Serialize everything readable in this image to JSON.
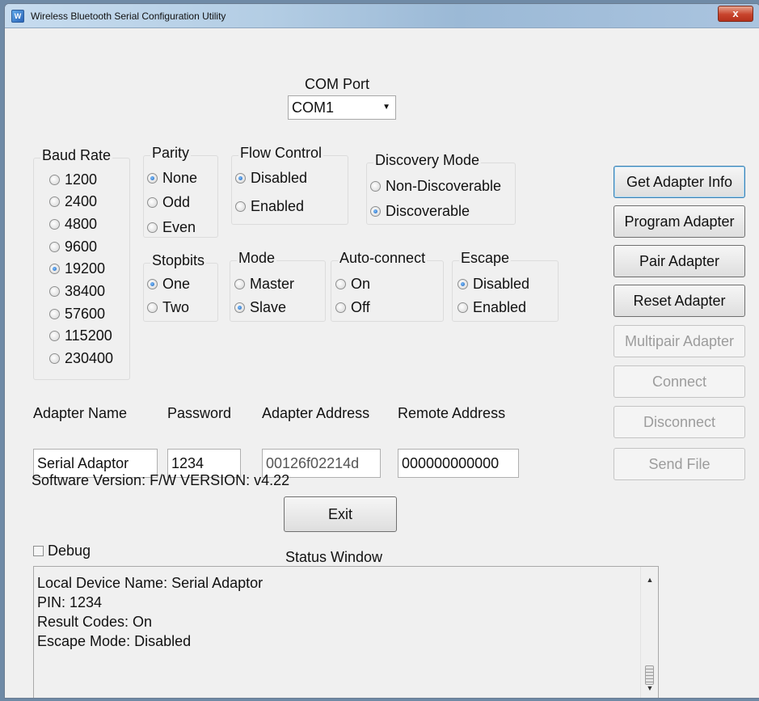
{
  "window": {
    "title": "Wireless Bluetooth Serial Configuration Utility",
    "close_glyph": "x",
    "icon": "bluetooth-app-icon"
  },
  "com_port": {
    "label": "COM Port",
    "value": "COM1"
  },
  "baud_rate": {
    "title": "Baud Rate",
    "options": [
      "1200",
      "2400",
      "4800",
      "9600",
      "19200",
      "38400",
      "57600",
      "115200",
      "230400"
    ],
    "selected": "19200"
  },
  "parity": {
    "title": "Parity",
    "options": [
      "None",
      "Odd",
      "Even"
    ],
    "selected": "None"
  },
  "flow_control": {
    "title": "Flow Control",
    "options": [
      "Disabled",
      "Enabled"
    ],
    "selected": "Disabled"
  },
  "discovery_mode": {
    "title": "Discovery Mode",
    "options": [
      "Non-Discoverable",
      "Discoverable"
    ],
    "selected": "Discoverable"
  },
  "stopbits": {
    "title": "Stopbits",
    "options": [
      "One",
      "Two"
    ],
    "selected": "One"
  },
  "mode": {
    "title": "Mode",
    "options": [
      "Master",
      "Slave"
    ],
    "selected": "Slave"
  },
  "auto_connect": {
    "title": "Auto-connect",
    "options": [
      "On",
      "Off"
    ],
    "selected": ""
  },
  "escape": {
    "title": "Escape",
    "options": [
      "Disabled",
      "Enabled"
    ],
    "selected": "Disabled"
  },
  "buttons": {
    "get_adapter_info": "Get Adapter Info",
    "program_adapter": "Program Adapter",
    "pair_adapter": "Pair Adapter",
    "reset_adapter": "Reset Adapter",
    "multipair_adapter": "Multipair Adapter",
    "connect": "Connect",
    "disconnect": "Disconnect",
    "send_file": "Send File",
    "exit": "Exit"
  },
  "fields": {
    "adapter_name_label": "Adapter Name",
    "adapter_name_value": "Serial Adaptor",
    "password_label": "Password",
    "password_value": "1234",
    "adapter_address_label": "Adapter Address",
    "adapter_address_value": "00126f02214d",
    "remote_address_label": "Remote Address",
    "remote_address_value": "000000000000"
  },
  "software_version": "Software Version: F/W VERSION: v4.22",
  "debug_label": "Debug",
  "status_window": {
    "title": "Status Window",
    "lines": [
      "Local Device Name: Serial Adaptor",
      "PIN: 1234",
      "Result Codes: On",
      "Escape Mode: Disabled"
    ]
  },
  "colors": {
    "default_button_border": "#3c7fb1",
    "disabled_text": "#9c9c9c",
    "close_button": "#c8432c"
  }
}
